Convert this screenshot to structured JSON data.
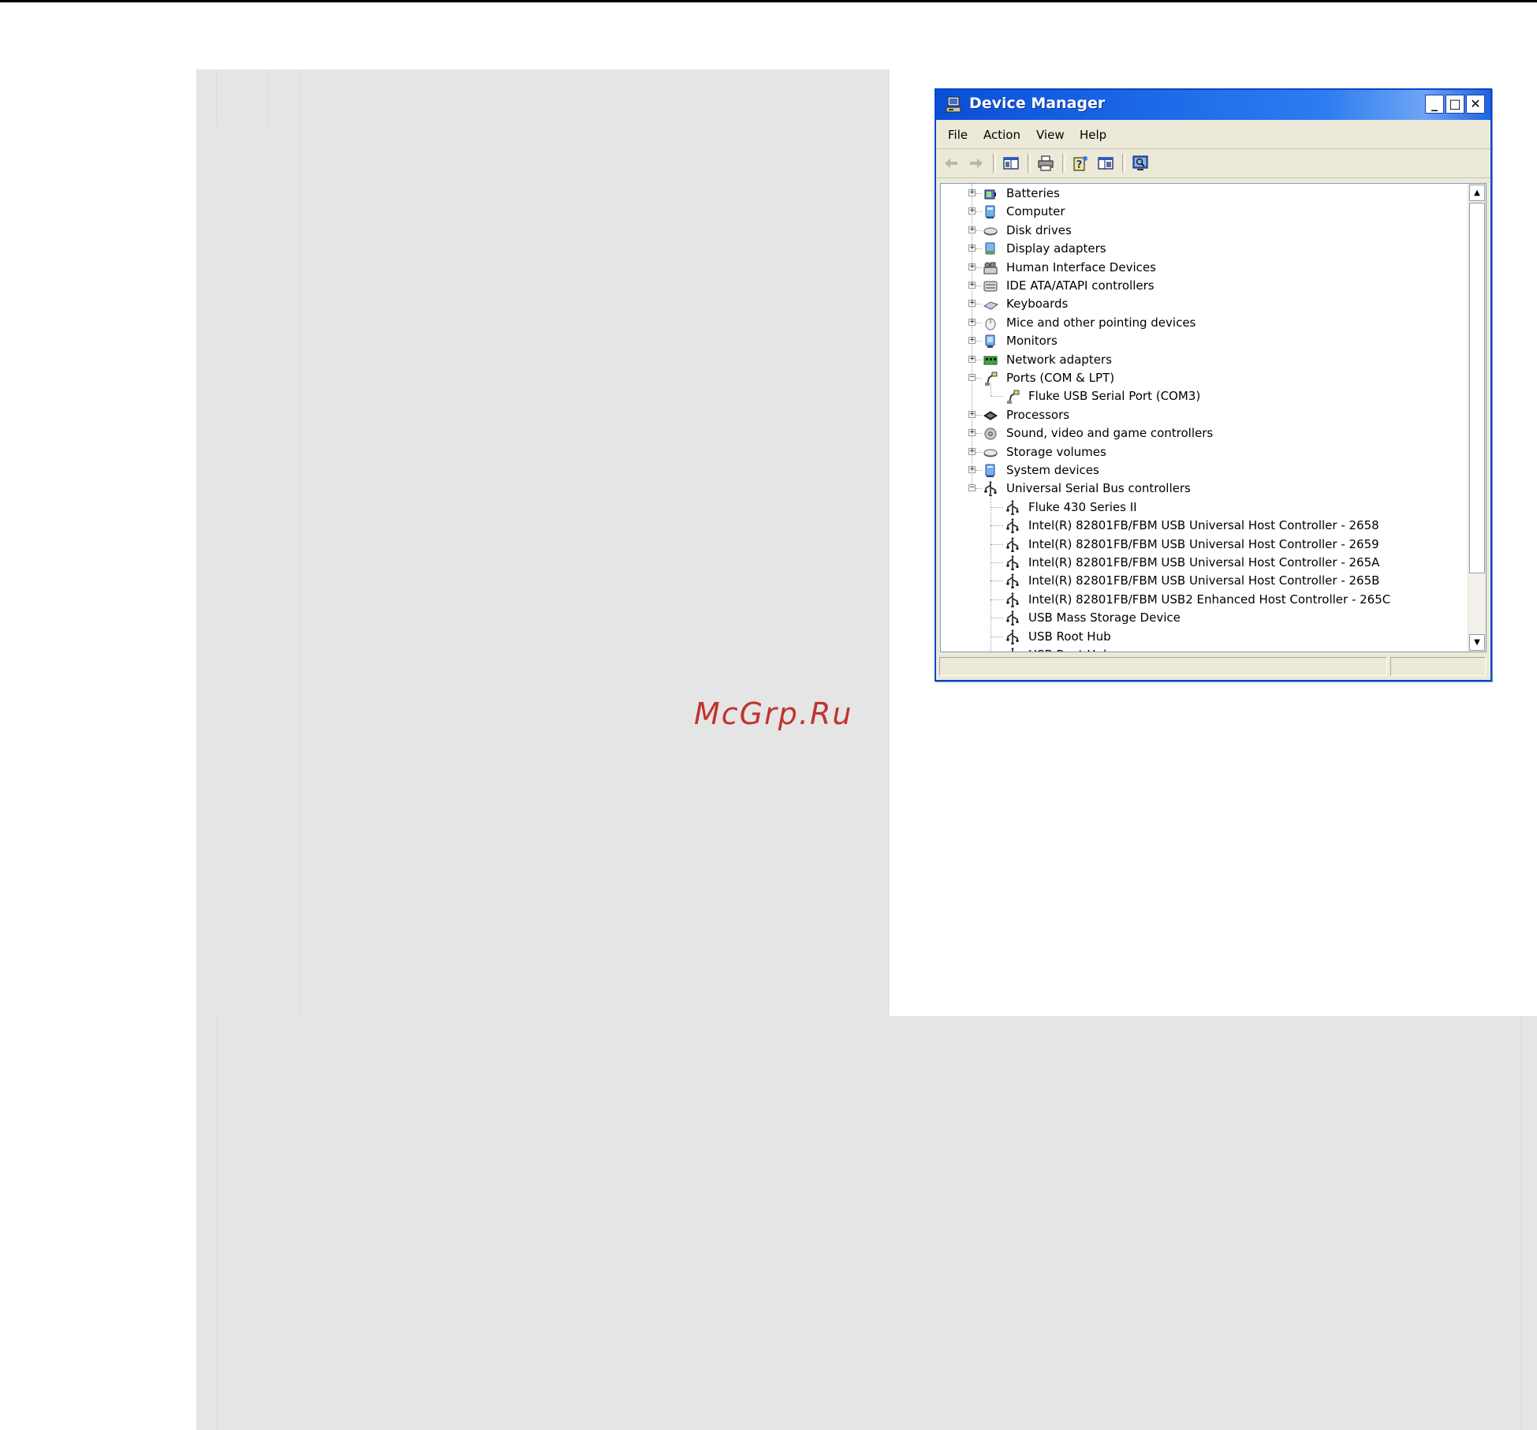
{
  "watermark": "McGrp.Ru",
  "window": {
    "title": "Device Manager",
    "controls": {
      "minimize": "_",
      "maximize": "□",
      "close": "✕"
    }
  },
  "menu": [
    "File",
    "Action",
    "View",
    "Help"
  ],
  "toolbar": [
    "back-icon",
    "forward-icon",
    "show-hide-console-tree-icon",
    "print-icon",
    "help-icon",
    "properties-icon",
    "scan-hardware-icon"
  ],
  "tree": {
    "categories": [
      {
        "label": "Batteries",
        "icon": "battery-icon",
        "expanded": false
      },
      {
        "label": "Computer",
        "icon": "computer-icon",
        "expanded": false
      },
      {
        "label": "Disk drives",
        "icon": "disk-drive-icon",
        "expanded": false
      },
      {
        "label": "Display adapters",
        "icon": "display-adapter-icon",
        "expanded": false
      },
      {
        "label": "Human Interface Devices",
        "icon": "hid-icon",
        "expanded": false
      },
      {
        "label": "IDE ATA/ATAPI controllers",
        "icon": "ide-controller-icon",
        "expanded": false
      },
      {
        "label": "Keyboards",
        "icon": "keyboard-icon",
        "expanded": false
      },
      {
        "label": "Mice and other pointing devices",
        "icon": "mouse-icon",
        "expanded": false
      },
      {
        "label": "Monitors",
        "icon": "monitor-icon",
        "expanded": false
      },
      {
        "label": "Network adapters",
        "icon": "network-adapter-icon",
        "expanded": false
      },
      {
        "label": "Ports (COM & LPT)",
        "icon": "port-icon",
        "expanded": true,
        "children": [
          {
            "label": "Fluke USB Serial Port (COM3)",
            "icon": "port-icon"
          }
        ]
      },
      {
        "label": "Processors",
        "icon": "processor-icon",
        "expanded": false
      },
      {
        "label": "Sound, video and game controllers",
        "icon": "sound-icon",
        "expanded": false
      },
      {
        "label": "Storage volumes",
        "icon": "storage-volume-icon",
        "expanded": false
      },
      {
        "label": "System devices",
        "icon": "system-device-icon",
        "expanded": false
      },
      {
        "label": "Universal Serial Bus controllers",
        "icon": "usb-icon",
        "expanded": true,
        "children": [
          {
            "label": "Fluke 430 Series II",
            "icon": "usb-icon"
          },
          {
            "label": "Intel(R) 82801FB/FBM USB Universal Host Controller - 2658",
            "icon": "usb-icon"
          },
          {
            "label": "Intel(R) 82801FB/FBM USB Universal Host Controller - 2659",
            "icon": "usb-icon"
          },
          {
            "label": "Intel(R) 82801FB/FBM USB Universal Host Controller - 265A",
            "icon": "usb-icon"
          },
          {
            "label": "Intel(R) 82801FB/FBM USB Universal Host Controller - 265B",
            "icon": "usb-icon"
          },
          {
            "label": "Intel(R) 82801FB/FBM USB2 Enhanced Host Controller - 265C",
            "icon": "usb-icon"
          },
          {
            "label": "USB Mass Storage Device",
            "icon": "usb-icon"
          },
          {
            "label": "USB Root Hub",
            "icon": "usb-icon"
          },
          {
            "label": "USB Root Hub",
            "icon": "usb-icon"
          }
        ]
      }
    ]
  },
  "scrollbar": {
    "up": "▲",
    "down": "▼"
  },
  "status": {
    "pane1": "",
    "pane2": ""
  }
}
